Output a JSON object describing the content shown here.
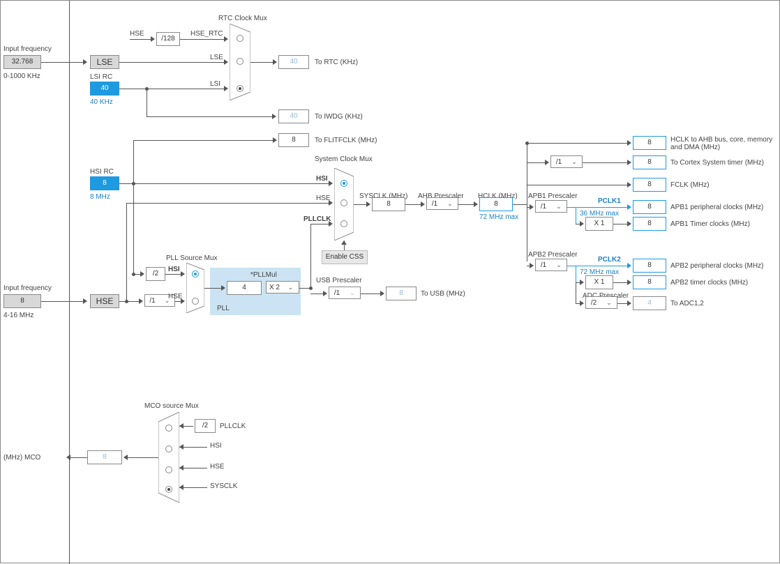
{
  "left": {
    "input_freq_label": "Input frequency",
    "lse_freq": "32.768",
    "lse_range": "0-1000 KHz",
    "hse_input_freq": "8",
    "hse_range": "4-16 MHz",
    "mco_label": "(MHz) MCO"
  },
  "sources": {
    "lse_label": "LSE",
    "lsi_label": "LSI RC",
    "lsi_val": "40",
    "lsi_note": "40 KHz",
    "hsi_label": "HSI RC",
    "hsi_val": "8",
    "hsi_note": "8 MHz",
    "hse_label": "HSE",
    "hse_div": "/1"
  },
  "rtc": {
    "title": "RTC Clock Mux",
    "hse_label": "HSE",
    "hse_div": "/128",
    "hse_rtc": "HSE_RTC",
    "lse_label": "LSE",
    "lsi_label": "LSI",
    "out": "40",
    "out_label": "To RTC (KHz)"
  },
  "iwdg": {
    "val": "40",
    "label": "To IWDG (KHz)"
  },
  "flit": {
    "val": "8",
    "label": "To FLITFCLK (MHz)"
  },
  "pll": {
    "title": "PLL Source Mux",
    "div2": "/2",
    "hsi": "HSI",
    "hse": "HSE",
    "in_val": "4",
    "mul_label": "*PLLMul",
    "mul": "X 2",
    "pll_label": "PLL"
  },
  "usb": {
    "title": "USB Prescaler",
    "div": "/1",
    "val": "8",
    "label": "To USB (MHz)"
  },
  "sys": {
    "title": "System Clock Mux",
    "hsi": "HSI",
    "hse": "HSE",
    "pllclk": "PLLCLK",
    "css": "Enable CSS",
    "sysclk_label": "SYSCLK (MHz)",
    "sysclk": "8",
    "ahb_label": "AHB Prescaler",
    "ahb": "/1",
    "hclk_label": "HCLK (MHz)",
    "hclk": "8",
    "hclk_note": "72 MHz max"
  },
  "out": {
    "hclk_ahb": {
      "val": "8",
      "label": "HCLK to AHB bus, core,\nmemory and DMA (MHz)"
    },
    "cortex": {
      "div": "/1",
      "val": "8",
      "label": "To Cortex System timer (MHz)"
    },
    "fclk": {
      "val": "8",
      "label": "FCLK (MHz)"
    },
    "apb1": {
      "title": "APB1 Prescaler",
      "div": "/1",
      "pclk": "PCLK1",
      "max": "36 MHz max",
      "periph": "8",
      "periph_label": "APB1 peripheral clocks (MHz)",
      "mul": "X 1",
      "timer": "8",
      "timer_label": "APB1 Timer clocks (MHz)"
    },
    "apb2": {
      "title": "APB2 Prescaler",
      "div": "/1",
      "pclk": "PCLK2",
      "max": "72 MHz max",
      "periph": "8",
      "periph_label": "APB2 peripheral clocks (MHz)",
      "mul": "X 1",
      "timer": "8",
      "timer_label": "APB2 timer clocks (MHz)"
    },
    "adc": {
      "title": "ADC Prescaler",
      "div": "/2",
      "val": "4",
      "label": "To ADC1,2"
    }
  },
  "mco": {
    "title": "MCO source Mux",
    "div2": "/2",
    "pllclk": "PLLCLK",
    "hsi": "HSI",
    "hse": "HSE",
    "sysclk": "SYSCLK",
    "out": "8"
  }
}
